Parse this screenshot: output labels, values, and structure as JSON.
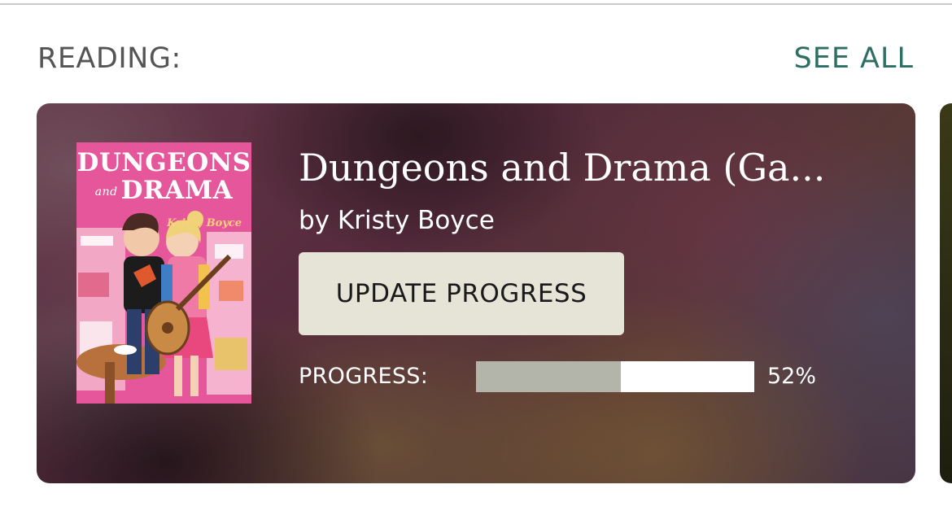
{
  "section": {
    "label": "READING:",
    "see_all": "SEE ALL"
  },
  "current_book": {
    "title": "Dungeons and Drama (Ga...",
    "author": "by Kristy Boyce",
    "cover": {
      "title_line1": "DUNGEONS",
      "title_and": "and",
      "title_line2": "DRAMA",
      "author": "Kristy Boyce",
      "background_color": "#e5579a"
    },
    "update_button_label": "UPDATE PROGRESS",
    "progress_label": "PROGRESS:",
    "progress_text": "52%",
    "progress_fraction": 0.52
  },
  "colors": {
    "accent": "#2f6e64",
    "button_bg": "#e6e3d7",
    "progress_fill": "#b3b4aa"
  }
}
